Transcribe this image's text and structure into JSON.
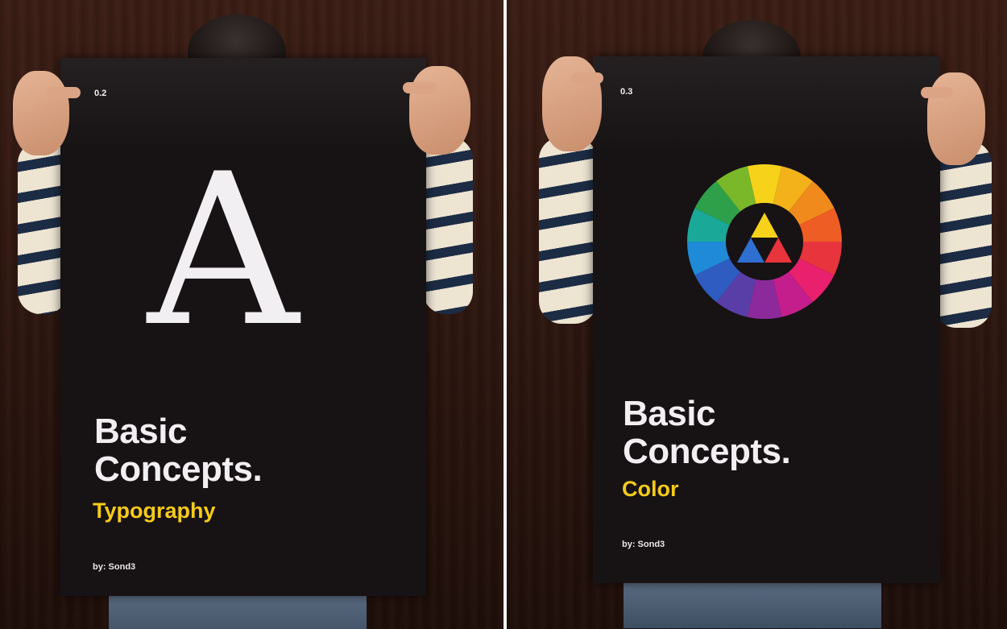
{
  "posters": [
    {
      "issue": "0.2",
      "headline_line1": "Basic",
      "headline_line2": "Concepts.",
      "subtitle": "Typography",
      "byline": "by: Sond3",
      "glyph": "A"
    },
    {
      "issue": "0.3",
      "headline_line1": "Basic",
      "headline_line2": "Concepts.",
      "subtitle": "Color",
      "byline": "by: Sond3",
      "color_wheel": {
        "segments": [
          "#f6d21a",
          "#f3b21a",
          "#f08a1c",
          "#ee5d24",
          "#e8343c",
          "#e8206e",
          "#c41e8c",
          "#8c2a9c",
          "#5a3ea8",
          "#2e5cc0",
          "#1e8ad8",
          "#1aa898",
          "#2ea04a",
          "#7ab82a"
        ],
        "inner_triangle": [
          "#f6d21a",
          "#e8343c",
          "#2e6fd0"
        ]
      }
    }
  ],
  "colors": {
    "poster_background": "#171213",
    "headline": "#f1eff2",
    "subtitle_accent": "#f5cb17",
    "wall": "#3b1e15"
  }
}
